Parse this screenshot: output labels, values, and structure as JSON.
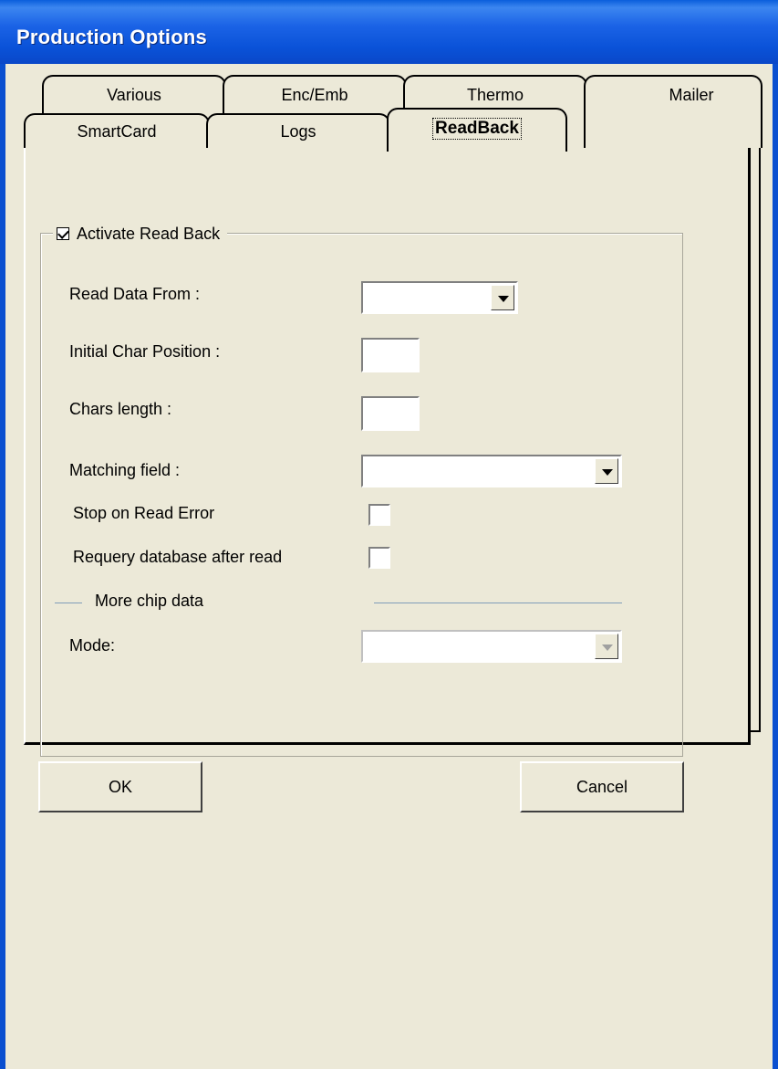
{
  "window": {
    "title": "Production Options"
  },
  "tabs": {
    "row_back": [
      "Various",
      "Enc/Emb",
      "Thermo",
      "Mailer"
    ],
    "row_front": [
      "SmartCard",
      "Logs",
      "ReadBack"
    ],
    "active": "ReadBack"
  },
  "readback": {
    "activate_label": "Activate Read Back",
    "activate_checked": true,
    "read_data_from_label": "Read Data From :",
    "read_data_from_value": "",
    "initial_char_position_label": "Initial Char Position :",
    "initial_char_position_value": "",
    "chars_length_label": "Chars length :",
    "chars_length_value": "",
    "matching_field_label": "Matching field :",
    "matching_field_value": "",
    "stop_on_read_error_label": "Stop on Read Error",
    "stop_on_read_error_checked": false,
    "requery_label": "Requery database after read",
    "requery_checked": false,
    "more_chip_data_label": "More chip data",
    "mode_label": "Mode:",
    "mode_value": ""
  },
  "buttons": {
    "ok": "OK",
    "cancel": "Cancel"
  },
  "colors": {
    "titlebar": "#0A5EDC",
    "face": "#ECE9D8",
    "separator": "#7F9DB9"
  }
}
